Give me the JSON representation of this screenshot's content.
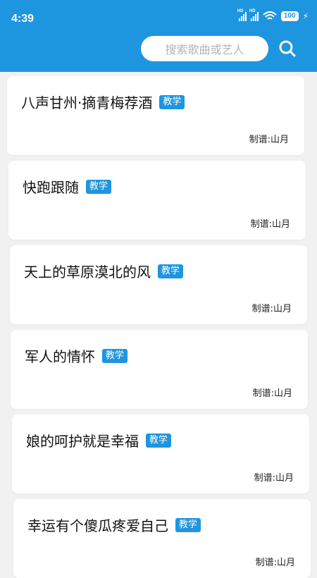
{
  "status_bar": {
    "time": "4:39",
    "battery": "100",
    "signal_labels": [
      "HD",
      "HD"
    ]
  },
  "search": {
    "placeholder": "搜索歌曲或艺人"
  },
  "songs": [
    {
      "title": "八声甘州·摘青梅荐酒",
      "tag": "教学",
      "author": "制谱:山月"
    },
    {
      "title": "快跑跟随",
      "tag": "教学",
      "author": "制谱:山月"
    },
    {
      "title": "天上的草原漠北的风",
      "tag": "教学",
      "author": "制谱:山月"
    },
    {
      "title": "军人的情怀",
      "tag": "教学",
      "author": "制谱:山月"
    },
    {
      "title": "娘的呵护就是幸福",
      "tag": "教学",
      "author": "制谱:山月"
    },
    {
      "title": "幸运有个傻瓜疼爱自己",
      "tag": "教学",
      "author": "制谱:山月"
    }
  ],
  "colors": {
    "accent": "#1e95df",
    "background": "#f1f1f1"
  }
}
